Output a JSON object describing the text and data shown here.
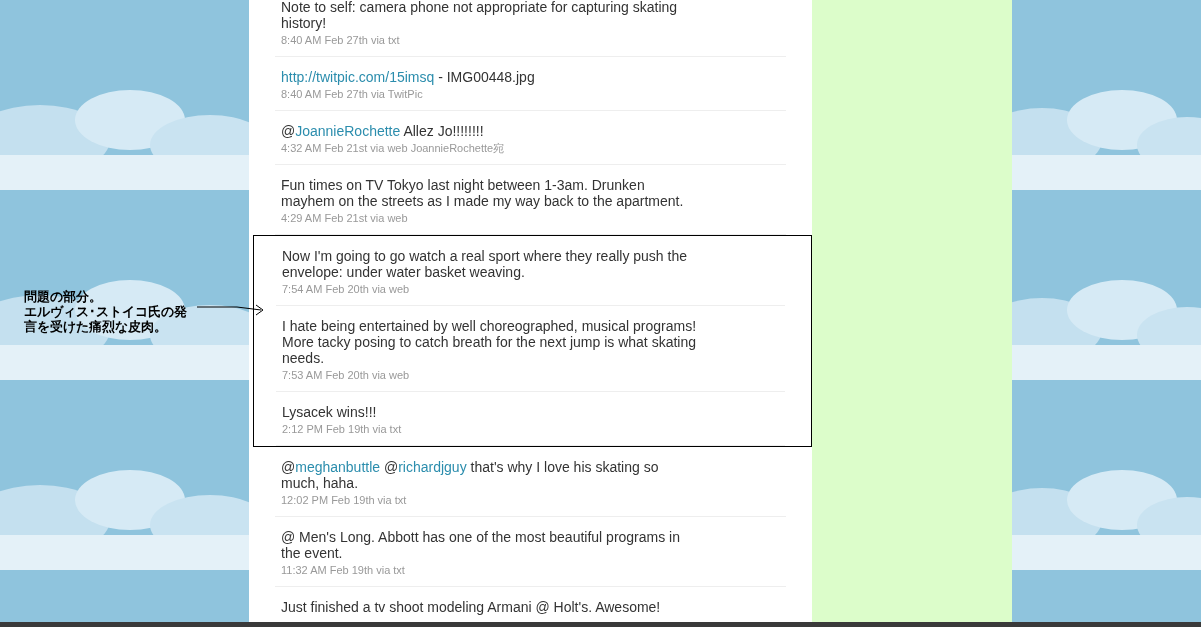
{
  "tweets": [
    {
      "parts": [
        {
          "kind": "plain",
          "text": "Note to self: camera phone not appropriate for capturing skating history!"
        }
      ],
      "meta": "8:40 AM Feb 27th via txt",
      "highlighted": false
    },
    {
      "parts": [
        {
          "kind": "link",
          "text": "http://twitpic.com/15imsq"
        },
        {
          "kind": "plain",
          "text": " - IMG00448.jpg"
        }
      ],
      "meta": "8:40 AM Feb 27th via TwitPic",
      "highlighted": false
    },
    {
      "parts": [
        {
          "kind": "plain",
          "text": "@"
        },
        {
          "kind": "link",
          "text": "JoannieRochette"
        },
        {
          "kind": "plain",
          "text": " Allez Jo!!!!!!!!"
        }
      ],
      "meta": "4:32 AM Feb 21st via web JoannieRochette宛",
      "highlighted": false
    },
    {
      "parts": [
        {
          "kind": "plain",
          "text": "Fun times on TV Tokyo last night between 1-3am. Drunken mayhem on the streets as I made my way back to the apartment."
        }
      ],
      "meta": "4:29 AM Feb 21st via web",
      "highlighted": false
    },
    {
      "parts": [
        {
          "kind": "plain",
          "text": "Now I'm going to go watch a real sport where they really push the envelope: under water basket weaving."
        }
      ],
      "meta": "7:54 AM Feb 20th via web",
      "highlighted": true
    },
    {
      "parts": [
        {
          "kind": "plain",
          "text": "I hate being entertained by well choreographed, musical programs! More tacky posing to catch breath for the next jump is what skating needs."
        }
      ],
      "meta": "7:53 AM Feb 20th via web",
      "highlighted": true
    },
    {
      "parts": [
        {
          "kind": "plain",
          "text": "Lysacek wins!!!"
        }
      ],
      "meta": "2:12 PM Feb 19th via txt",
      "highlighted": true
    },
    {
      "parts": [
        {
          "kind": "plain",
          "text": "@"
        },
        {
          "kind": "link",
          "text": "meghanbuttle"
        },
        {
          "kind": "plain",
          "text": " @"
        },
        {
          "kind": "link",
          "text": "richardjguy"
        },
        {
          "kind": "plain",
          "text": " that's why I love his skating so much, haha."
        }
      ],
      "meta": "12:02 PM Feb 19th via txt",
      "highlighted": false
    },
    {
      "parts": [
        {
          "kind": "plain",
          "text": "@ Men's Long. Abbott has one of the most beautiful programs in the event."
        }
      ],
      "meta": "11:32 AM Feb 19th via txt",
      "highlighted": false
    },
    {
      "parts": [
        {
          "kind": "plain",
          "text": "Just finished a tv shoot modeling Armani @ Holt's. Awesome!"
        }
      ],
      "highlighted": false
    }
  ],
  "annotation": {
    "lines": [
      "問題の部分。",
      "エルヴィス･ストイコ氏の発言を受けた痛烈な皮肉。"
    ]
  }
}
